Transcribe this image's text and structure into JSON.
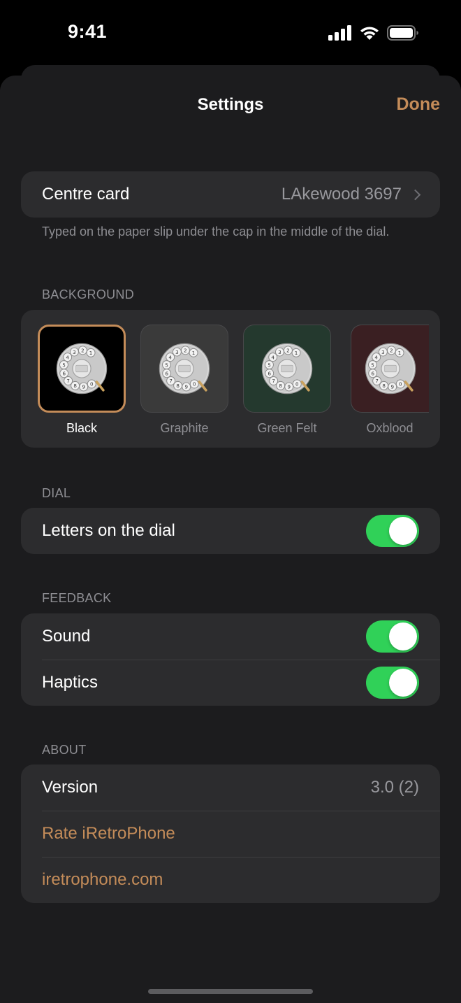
{
  "status_bar": {
    "time": "9:41"
  },
  "nav": {
    "title": "Settings",
    "done_label": "Done"
  },
  "centre_card": {
    "label": "Centre card",
    "value": "LAkewood 3697",
    "footer": "Typed on the paper slip under the cap in the middle of the dial."
  },
  "background": {
    "header": "BACKGROUND",
    "options": [
      {
        "label": "Black",
        "color": "#000000",
        "selected": true
      },
      {
        "label": "Graphite",
        "color": "#3a3a3a",
        "selected": false
      },
      {
        "label": "Green Felt",
        "color": "#24392e",
        "selected": false
      },
      {
        "label": "Oxblood",
        "color": "#3a1f22",
        "selected": false
      }
    ]
  },
  "dial": {
    "header": "DIAL",
    "letters_label": "Letters on the dial",
    "letters_on": true
  },
  "feedback": {
    "header": "FEEDBACK",
    "sound_label": "Sound",
    "sound_on": true,
    "haptics_label": "Haptics",
    "haptics_on": true
  },
  "about": {
    "header": "ABOUT",
    "version_label": "Version",
    "version_value": "3.0 (2)",
    "rate_label": "Rate iRetroPhone",
    "website_label": "iretrophone.com"
  },
  "colors": {
    "accent": "#c48c59",
    "toggle_on": "#30d158",
    "sheet_bg": "#1c1c1e",
    "group_bg": "#2c2c2e"
  }
}
